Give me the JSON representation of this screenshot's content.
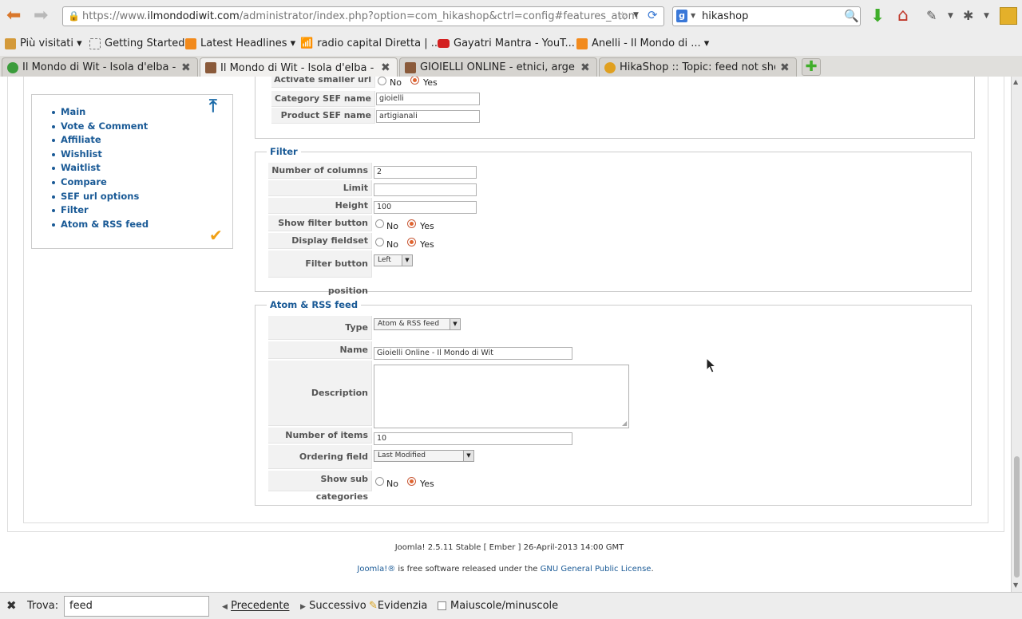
{
  "browser": {
    "url_prefix": "https://www.",
    "url_domain": "ilmondodiwit.com",
    "url_rest": "/administrator/index.php?option=com_hikashop&ctrl=config#features_atom",
    "search_value": "hikashop",
    "bookmarks": [
      {
        "label": "Più visitati ▾"
      },
      {
        "label": "Getting Started"
      },
      {
        "label": "Latest Headlines ▾"
      },
      {
        "label": "radio capital Diretta | ..."
      },
      {
        "label": "Gayatri Mantra - YouT..."
      },
      {
        "label": "Anelli - Il Mondo di ... ▾"
      }
    ],
    "tabs": [
      {
        "title": "Il Mondo di Wit - Isola d'elba - A..."
      },
      {
        "title": "Il Mondo di Wit - Isola d'elba - A..."
      },
      {
        "title": "GIOIELLI ONLINE - etnici, argen..."
      },
      {
        "title": "HikaShop :: Topic: feed not sho..."
      }
    ]
  },
  "sidenav": {
    "items": [
      "Main",
      "Vote & Comment",
      "Affiliate",
      "Wishlist",
      "Waitlist",
      "Compare",
      "SEF url options",
      "Filter",
      "Atom & RSS feed"
    ]
  },
  "sef": {
    "activate_label": "Activate smaller url",
    "no": "No",
    "yes": "Yes",
    "category_label": "Category SEF name",
    "category_value": "gioielli",
    "product_label": "Product SEF name",
    "product_value": "artigianali"
  },
  "filter": {
    "legend": "Filter",
    "columns_label": "Number of columns",
    "columns_value": "2",
    "limit_label": "Limit",
    "limit_value": "",
    "height_label": "Height",
    "height_value": "100",
    "show_button_label": "Show filter button",
    "fieldset_label": "Display fieldset",
    "position_label": "Filter button position",
    "position_value": "Left",
    "no": "No",
    "yes": "Yes"
  },
  "atom": {
    "legend": "Atom & RSS feed",
    "type_label": "Type",
    "type_value": "Atom & RSS feed",
    "name_label": "Name",
    "name_value": "Gioielli Online - Il Mondo di Wit",
    "description_label": "Description",
    "description_value": "",
    "items_label": "Number of items",
    "items_value": "10",
    "ordering_label": "Ordering field",
    "ordering_value": "Last Modified",
    "subcat_label": "Show sub categories",
    "no": "No",
    "yes": "Yes"
  },
  "footer": {
    "version": "Joomla! 2.5.11 Stable [ Ember ] 26-April-2013 14:00 GMT",
    "joomla": "Joomla!®",
    "license_mid": " is free software released under the ",
    "license_link": "GNU General Public License",
    "license_end": "."
  },
  "findbar": {
    "label": "Trova:",
    "value": "feed",
    "prev": "Precedente",
    "next": "Successivo",
    "highlight": "Evidenzia",
    "matchcase": "Maiuscole/minuscole"
  },
  "colors": {
    "link": "#1a5a96",
    "accent_radio": "#e0642f"
  }
}
